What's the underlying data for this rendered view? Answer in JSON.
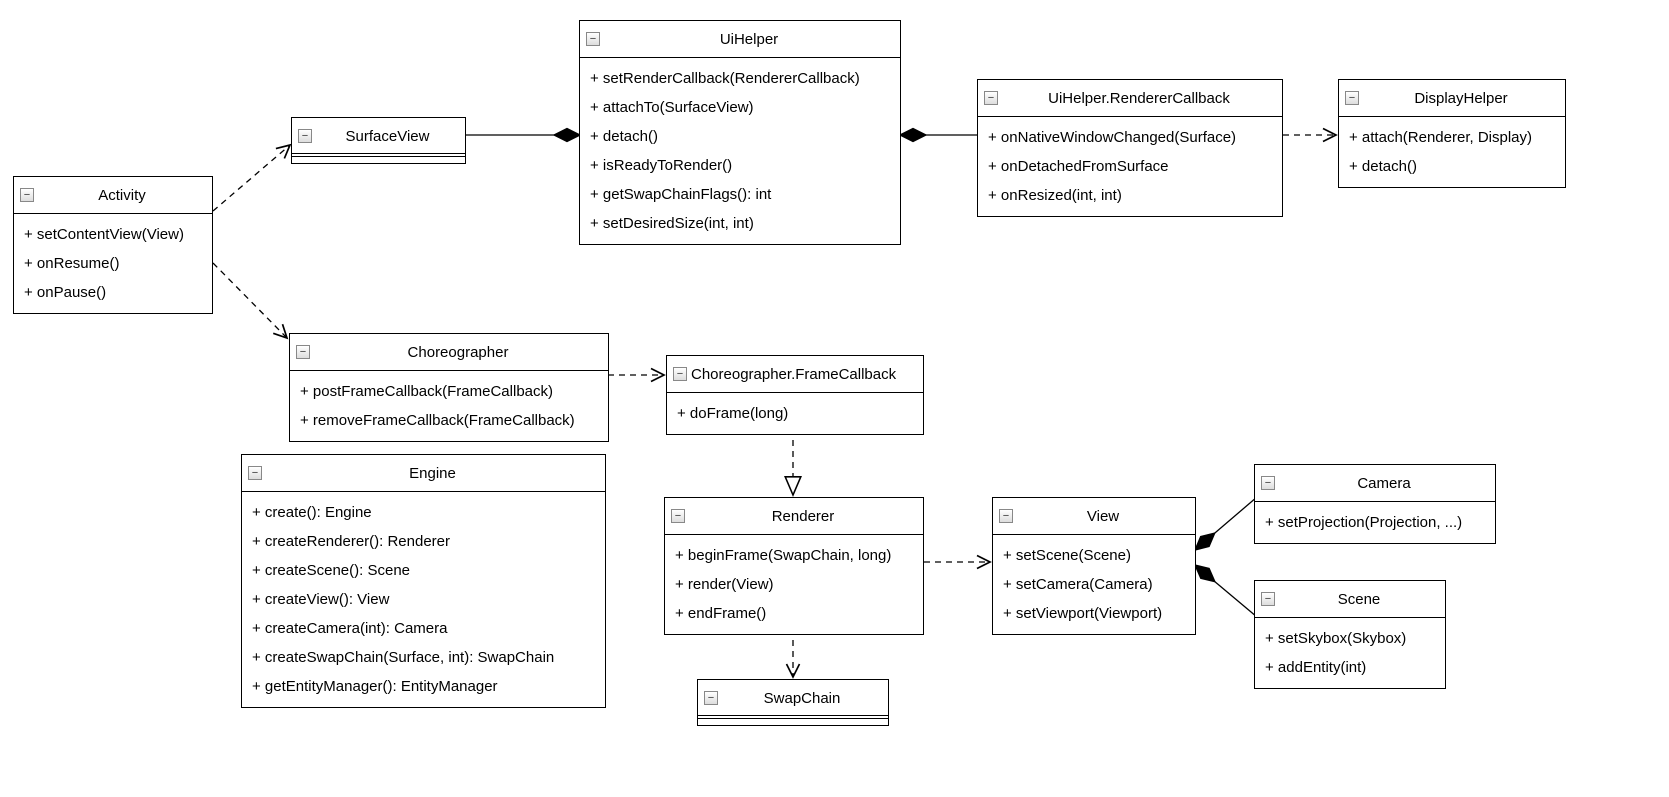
{
  "diagram_type": "uml-class-diagram",
  "classes": {
    "activity": {
      "title": "Activity",
      "members": [
        "+ setContentView(View)",
        "+ onResume()",
        "+ onPause()"
      ]
    },
    "surfaceView": {
      "title": "SurfaceView",
      "members": []
    },
    "uiHelper": {
      "title": "UiHelper",
      "members": [
        "+ setRenderCallback(RendererCallback)",
        "+ attachTo(SurfaceView)",
        "+ detach()",
        "+ isReadyToRender()",
        "+ getSwapChainFlags(): int",
        "+ setDesiredSize(int, int)"
      ]
    },
    "rendererCallback": {
      "title": "UiHelper.RendererCallback",
      "members": [
        "+ onNativeWindowChanged(Surface)",
        "+ onDetachedFromSurface",
        "+ onResized(int, int)"
      ]
    },
    "displayHelper": {
      "title": "DisplayHelper",
      "members": [
        "+ attach(Renderer, Display)",
        "+ detach()"
      ]
    },
    "choreographer": {
      "title": "Choreographer",
      "members": [
        "+ postFrameCallback(FrameCallback)",
        "+ removeFrameCallback(FrameCallback)"
      ]
    },
    "frameCallback": {
      "title": "Choreographer.FrameCallback",
      "members": [
        "+ doFrame(long)"
      ]
    },
    "engine": {
      "title": "Engine",
      "members": [
        "+ create(): Engine",
        "+ createRenderer(): Renderer",
        "+ createScene(): Scene",
        "+ createView(): View",
        "+ createCamera(int): Camera",
        "+ createSwapChain(Surface, int): SwapChain",
        "+ getEntityManager(): EntityManager"
      ]
    },
    "renderer": {
      "title": "Renderer",
      "members": [
        "+ beginFrame(SwapChain, long)",
        "+ render(View)",
        "+ endFrame()"
      ]
    },
    "swapChain": {
      "title": "SwapChain",
      "members": []
    },
    "view": {
      "title": "View",
      "members": [
        "+ setScene(Scene)",
        "+ setCamera(Camera)",
        "+ setViewport(Viewport)"
      ]
    },
    "camera": {
      "title": "Camera",
      "members": [
        "+ setProjection(Projection, ...)"
      ]
    },
    "scene": {
      "title": "Scene",
      "members": [
        "+ setSkybox(Skybox)",
        "+ addEntity(int)"
      ]
    }
  }
}
